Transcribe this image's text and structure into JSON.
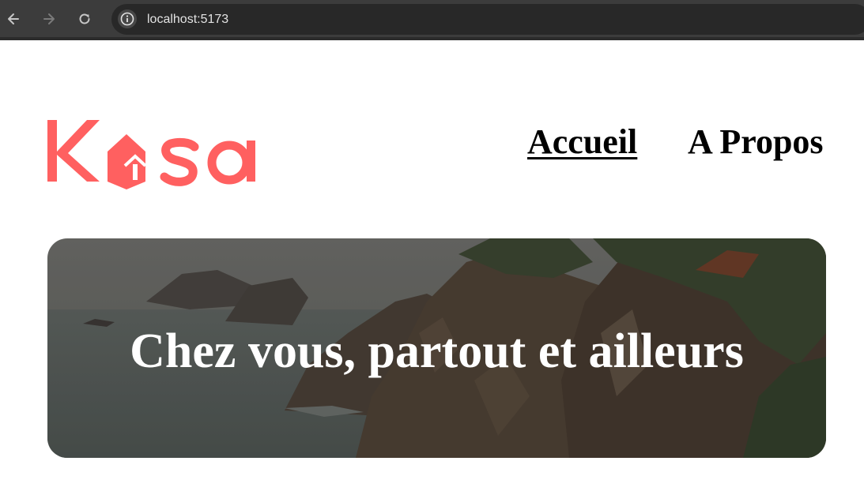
{
  "browser": {
    "url": "localhost:5173",
    "icons": {
      "back": "arrow-left-icon",
      "forward": "arrow-right-icon",
      "reload": "reload-icon",
      "info": "info-icon"
    }
  },
  "header": {
    "logo_text": "Kasa",
    "logo_color": "#FF6060",
    "nav": [
      {
        "label": "Accueil",
        "active": true
      },
      {
        "label": "A Propos",
        "active": false
      }
    ]
  },
  "banner": {
    "title": "Chez vous, partout et ailleurs",
    "image": "coastal-cliffs-photo"
  },
  "colors": {
    "brand": "#FF6060",
    "browser_chrome": "#3C3C3C",
    "url_bar": "#282828"
  }
}
